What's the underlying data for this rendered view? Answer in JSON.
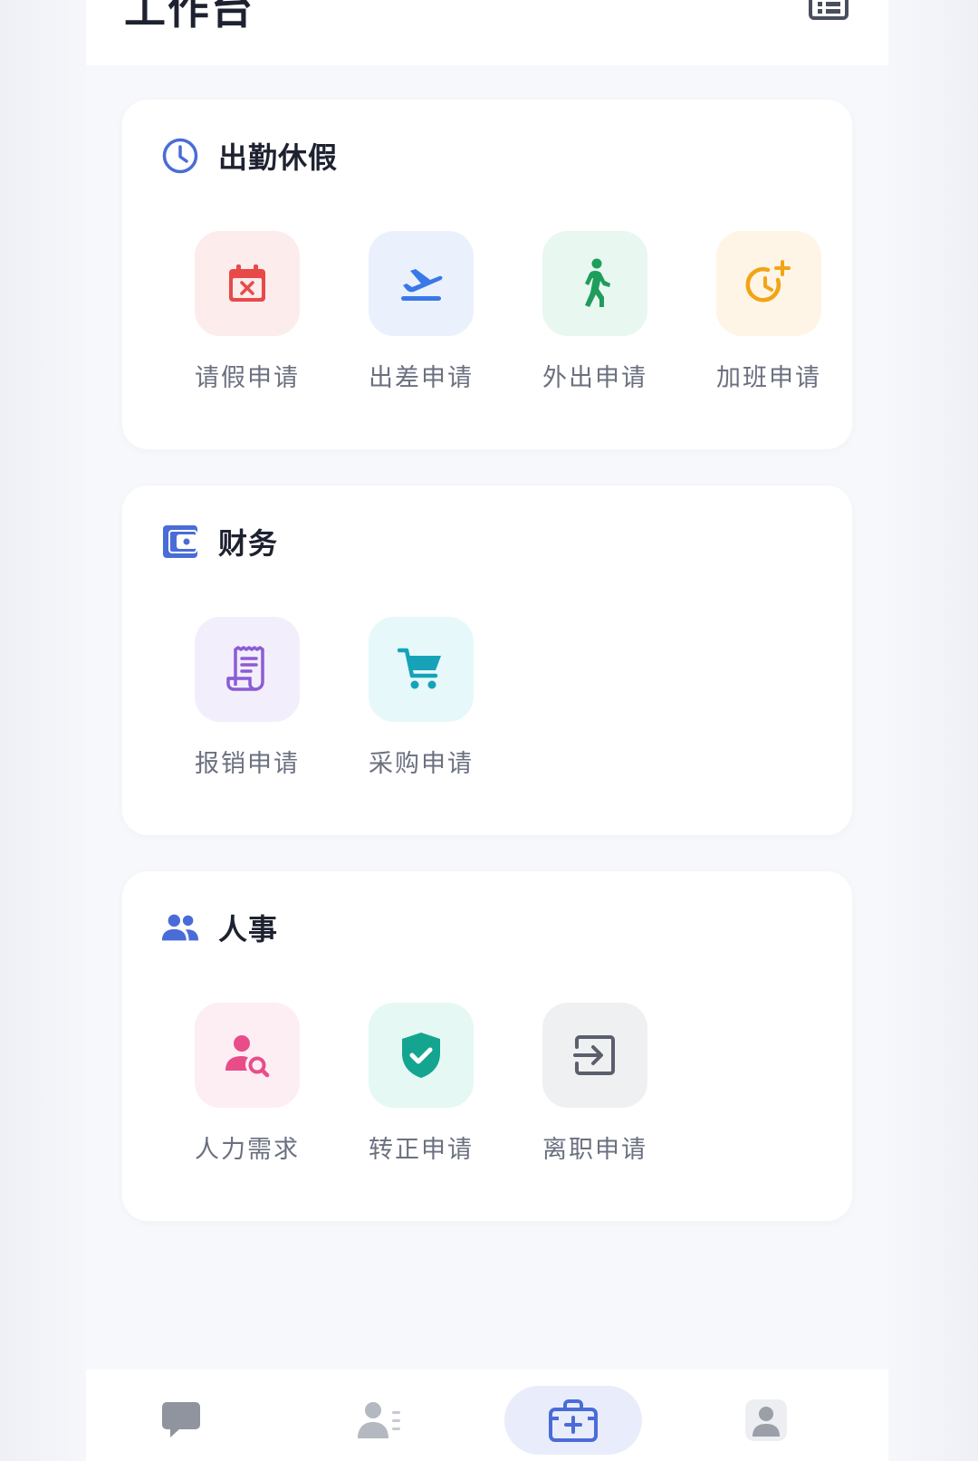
{
  "header": {
    "title": "工作台",
    "list_icon": "list-icon"
  },
  "sections": [
    {
      "title": "出勤休假",
      "icon": "clock-icon",
      "items": [
        {
          "label": "请假申请",
          "icon": "calendar-x-icon",
          "color": "#e84a4a",
          "bg": "#fdecec"
        },
        {
          "label": "出差申请",
          "icon": "plane-takeoff-icon",
          "color": "#3a78e8",
          "bg": "#eaf1fd"
        },
        {
          "label": "外出申请",
          "icon": "walking-icon",
          "color": "#1f9d5c",
          "bg": "#e8f7ef"
        },
        {
          "label": "加班申请",
          "icon": "clock-plus-icon",
          "color": "#f2a417",
          "bg": "#fef5e6"
        }
      ]
    },
    {
      "title": "财务",
      "icon": "wallet-icon",
      "items": [
        {
          "label": "报销申请",
          "icon": "receipt-icon",
          "color": "#8b5cd6",
          "bg": "#f3eefc"
        },
        {
          "label": "采购申请",
          "icon": "cart-icon",
          "color": "#16a3b8",
          "bg": "#e6f8fa"
        }
      ]
    },
    {
      "title": "人事",
      "icon": "users-icon",
      "items": [
        {
          "label": "人力需求",
          "icon": "user-search-icon",
          "color": "#e84d8a",
          "bg": "#fdeef4"
        },
        {
          "label": "转正申请",
          "icon": "shield-check-icon",
          "color": "#14a591",
          "bg": "#e5f8f4"
        },
        {
          "label": "离职申请",
          "icon": "exit-icon",
          "color": "#5a5f6b",
          "bg": "#eff0f2"
        }
      ]
    }
  ],
  "bottom_nav": [
    {
      "name": "messages",
      "icon": "chat-bubble-icon"
    },
    {
      "name": "contacts",
      "icon": "contacts-icon"
    },
    {
      "name": "workbench",
      "icon": "medkit-icon",
      "active": true
    },
    {
      "name": "profile",
      "icon": "profile-icon"
    }
  ],
  "colors": {
    "accent": "#4a6cd8",
    "title_text": "#1e2230",
    "label_text": "#6b7080"
  }
}
